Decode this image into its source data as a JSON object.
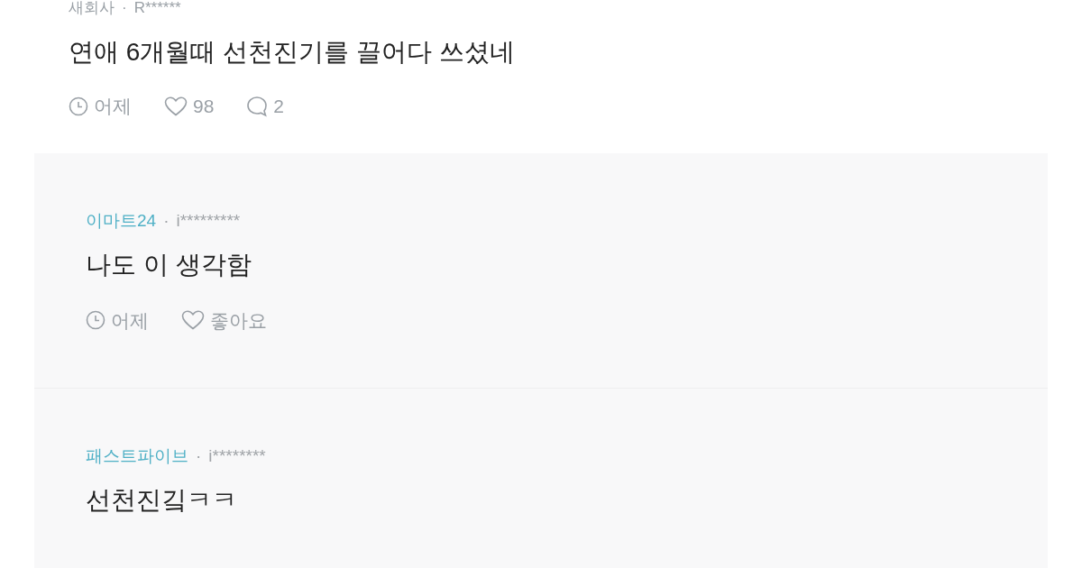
{
  "comment": {
    "company": "새회사",
    "separator": "·",
    "user": "R******",
    "text": "연애 6개월때 선천진기를 끌어다 쓰셨네",
    "time": "어제",
    "likes": "98",
    "replies_count": "2"
  },
  "replies": [
    {
      "company": "이마트24",
      "separator": "·",
      "user": "i*********",
      "text": "나도 이 생각함",
      "time": "어제",
      "like_label": "좋아요"
    },
    {
      "company": "패스트파이브",
      "separator": "·",
      "user": "i********",
      "text": "선천진깈ㅋㅋ"
    }
  ]
}
